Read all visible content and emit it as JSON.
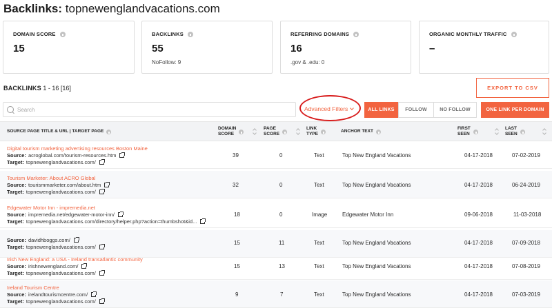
{
  "header": {
    "title_prefix": "Backlinks:",
    "domain": "topnewenglandvacations.com"
  },
  "cards": [
    {
      "label": "DOMAIN SCORE",
      "value": "15",
      "sub": ""
    },
    {
      "label": "BACKLINKS",
      "value": "55",
      "sub": "NoFollow: 9"
    },
    {
      "label": "REFERRING DOMAINS",
      "value": "16",
      "sub": ".gov & .edu: 0"
    },
    {
      "label": "ORGANIC MONTHLY TRAFFIC",
      "value": "–",
      "sub": ""
    }
  ],
  "section": {
    "title": "BACKLINKS",
    "range": "1 - 16 [16]"
  },
  "toolbar": {
    "export_label": "EXPORT TO CSV",
    "search_placeholder": "Search",
    "advanced_filters": "Advanced Filters",
    "all_links": "ALL LINKS",
    "follow": "FOLLOW",
    "no_follow": "NO FOLLOW",
    "one_link": "ONE LINK PER DOMAIN"
  },
  "columns": {
    "source": "SOURCE PAGE TITLE & URL | TARGET PAGE",
    "domain_score_1": "DOMAIN",
    "domain_score_2": "SCORE",
    "page_score_1": "PAGE",
    "page_score_2": "SCORE",
    "link_type_1": "LINK",
    "link_type_2": "TYPE",
    "anchor": "ANCHOR TEXT",
    "first_seen_1": "FIRST",
    "first_seen_2": "SEEN",
    "last_seen_1": "LAST",
    "last_seen_2": "SEEN"
  },
  "labels": {
    "source": "Source:",
    "target": "Target:"
  },
  "rows": [
    {
      "title": "Digital tourism marketing advertising resources Boston Maine",
      "source": "acroglobal.com/tourism-resources.htm",
      "target": "topnewenglandvacations.com/",
      "domain_score": "39",
      "page_score": "0",
      "type": "Text",
      "anchor": "Top New England Vacations",
      "first": "04-17-2018",
      "last": "07-02-2019"
    },
    {
      "title": "Tourism Marketer: About ACRO Global",
      "source": "tourismmarketer.com/about.htm",
      "target": "topnewenglandvacations.com/",
      "domain_score": "32",
      "page_score": "0",
      "type": "Text",
      "anchor": "Top New England Vacations",
      "first": "04-17-2018",
      "last": "06-24-2019"
    },
    {
      "title": "Edgewater Motor Inn - impremedia.net",
      "source": "impremedia.net/edgewater-motor-inn/",
      "target": "topnewenglandvacations.com/directory/helper.php?action=thumbshot&id...",
      "domain_score": "18",
      "page_score": "0",
      "type": "Image",
      "anchor": "Edgewater Motor Inn",
      "first": "09-06-2018",
      "last": "11-03-2018"
    },
    {
      "title": "",
      "source": "davidhboggs.com/",
      "target": "topnewenglandvacations.com/",
      "domain_score": "15",
      "page_score": "11",
      "type": "Text",
      "anchor": "Top New England Vacations",
      "first": "04-17-2018",
      "last": "07-09-2018"
    },
    {
      "title": "Irish New England: a USA - Ireland transatlantic community",
      "source": "irishnewengland.com/",
      "target": "topnewenglandvacations.com/",
      "domain_score": "15",
      "page_score": "13",
      "type": "Text",
      "anchor": "Top New England Vacations",
      "first": "04-17-2018",
      "last": "07-08-2019"
    },
    {
      "title": "Ireland Tourism Centre",
      "source": "irelandtourismcentre.com/",
      "target": "topnewenglandvacations.com/",
      "domain_score": "9",
      "page_score": "7",
      "type": "Text",
      "anchor": "Top New England Vacations",
      "first": "04-17-2018",
      "last": "07-03-2019"
    }
  ]
}
